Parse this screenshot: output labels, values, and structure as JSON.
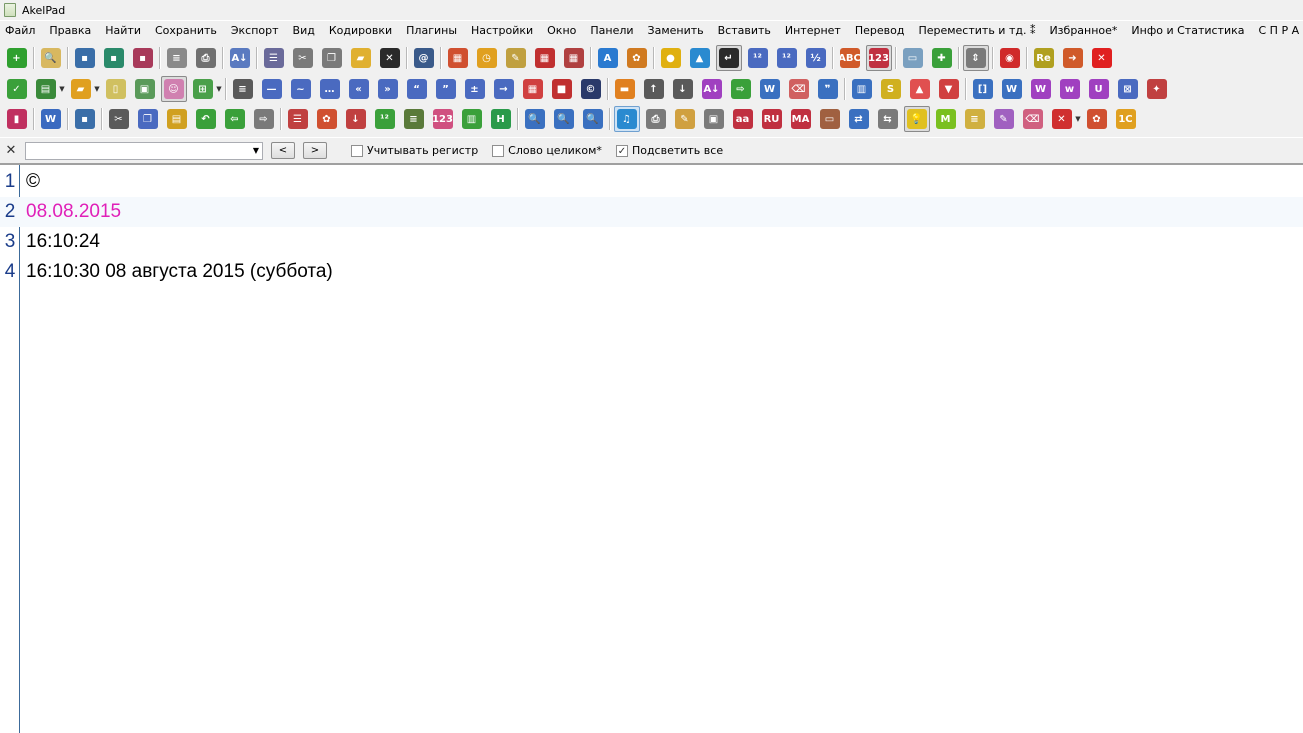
{
  "window": {
    "title": "AkelPad"
  },
  "menu": [
    "Файл",
    "Правка",
    "Найти",
    "Сохранить",
    "Экспорт",
    "Вид",
    "Кодировки",
    "Плагины",
    "Настройки",
    "Окно",
    "Панели",
    "Заменить",
    "Вставить",
    "Интернет",
    "Перевод",
    "Переместить и тд. ⁑",
    "Избранное*",
    "Инфо и Статистика",
    "С П Р А В К А"
  ],
  "toolbar": {
    "row1": [
      {
        "icon": "new-tab-icon",
        "color": "#2fa02f",
        "glyph": "+"
      },
      "sep",
      {
        "icon": "preview-icon",
        "color": "#d8b860",
        "glyph": "🔍"
      },
      "sep",
      {
        "icon": "save-icon",
        "color": "#3a6ea8",
        "glyph": "▪"
      },
      {
        "icon": "save-as-icon",
        "color": "#2a8a6a",
        "glyph": "▪"
      },
      {
        "icon": "save-all-icon",
        "color": "#a83a5a",
        "glyph": "▪"
      },
      "sep",
      {
        "icon": "document-icon",
        "color": "#8a8a8a",
        "glyph": "≡"
      },
      {
        "icon": "print-icon",
        "color": "#707070",
        "glyph": "⎙"
      },
      "sep",
      {
        "icon": "sort-icon",
        "color": "#5a7ac0",
        "glyph": "A↓"
      },
      "sep",
      {
        "icon": "list-icon",
        "color": "#6a6a9a",
        "glyph": "☰"
      },
      {
        "icon": "cut-icon",
        "color": "#7a7a7a",
        "glyph": "✂"
      },
      {
        "icon": "copy-icon",
        "color": "#7a7a7a",
        "glyph": "❐"
      },
      {
        "icon": "open-folder-icon",
        "color": "#e0b030",
        "glyph": "▰"
      },
      {
        "icon": "close-doc-icon",
        "color": "#2a2a2a",
        "glyph": "✕"
      },
      "sep",
      {
        "icon": "at-icon",
        "color": "#3a5a8a",
        "glyph": "@"
      },
      "sep",
      {
        "icon": "calendar-icon",
        "color": "#d05030",
        "glyph": "▦"
      },
      {
        "icon": "clock-icon",
        "color": "#e0a020",
        "glyph": "◷"
      },
      {
        "icon": "notes-icon",
        "color": "#c0a040",
        "glyph": "✎"
      },
      {
        "icon": "calendar-date-icon",
        "color": "#c03030",
        "glyph": "▦"
      },
      {
        "icon": "calendar-week-icon",
        "color": "#b04040",
        "glyph": "▦"
      },
      "sep",
      {
        "icon": "font-icon",
        "color": "#2a7ad0",
        "glyph": "A"
      },
      {
        "icon": "palette-icon",
        "color": "#d07a20",
        "glyph": "✿"
      },
      "sep",
      {
        "icon": "keyhole-icon",
        "color": "#e0b010",
        "glyph": "●"
      },
      {
        "icon": "triangle-up-icon",
        "color": "#2a8ad0",
        "glyph": "▲"
      },
      {
        "icon": "word-wrap-icon",
        "color": "#2a2a2a",
        "glyph": "↵",
        "state": "pressed"
      },
      {
        "icon": "numbering-icon",
        "color": "#4a6ac0",
        "glyph": "¹²"
      },
      {
        "icon": "numbering-inline-icon",
        "color": "#4a6ac0",
        "glyph": "¹²"
      },
      {
        "icon": "fraction-icon",
        "color": "#4a6ac0",
        "glyph": "½"
      },
      "sep",
      {
        "icon": "spellcheck-icon",
        "color": "#d05a2a",
        "glyph": "ABC"
      },
      {
        "icon": "numbers-123-icon",
        "color": "#c03040",
        "glyph": "123",
        "state": "pressed"
      },
      "sep",
      {
        "icon": "window-icon",
        "color": "#7aa0c0",
        "glyph": "▭"
      },
      {
        "icon": "plugin-icon",
        "color": "#3aa03a",
        "glyph": "✚"
      },
      "sep",
      {
        "icon": "scroll-icon",
        "color": "#7a7a7a",
        "glyph": "⇕",
        "state": "pressed"
      },
      "sep",
      {
        "icon": "stop-icon",
        "color": "#d02a2a",
        "glyph": "◉"
      },
      "sep",
      {
        "icon": "regex-icon",
        "color": "#b0a020",
        "glyph": "Re"
      },
      {
        "icon": "exit-icon",
        "color": "#d05a2a",
        "glyph": "➜"
      },
      {
        "icon": "close-red-icon",
        "color": "#e02020",
        "glyph": "✕"
      }
    ],
    "row2": [
      {
        "icon": "check-green-icon",
        "color": "#3aa03a",
        "glyph": "✓"
      },
      {
        "icon": "recent-files-icon",
        "color": "#3a8a3a",
        "glyph": "▤",
        "dropdown": true
      },
      {
        "icon": "open-icon",
        "color": "#e0a020",
        "glyph": "▰",
        "dropdown": true
      },
      {
        "icon": "new-file-icon",
        "color": "#d0c060",
        "glyph": "▯"
      },
      {
        "icon": "insert-file-icon",
        "color": "#5a9a5a",
        "glyph": "▣"
      },
      {
        "icon": "avatar-icon",
        "color": "#d080b0",
        "glyph": "☺",
        "state": "pressed"
      },
      {
        "icon": "grid-check-icon",
        "color": "#4aa04a",
        "glyph": "⊞",
        "dropdown": true
      },
      "sep",
      {
        "icon": "align-left-icon",
        "color": "#5a5a5a",
        "glyph": "≡"
      },
      {
        "icon": "minus-icon",
        "color": "#4a6ac0",
        "glyph": "—"
      },
      {
        "icon": "tilde-icon",
        "color": "#4a6ac0",
        "glyph": "~"
      },
      {
        "icon": "ellipsis-icon",
        "color": "#4a6ac0",
        "glyph": "…"
      },
      {
        "icon": "quote-left-icon",
        "color": "#4a6ac0",
        "glyph": "«"
      },
      {
        "icon": "quote-right-icon",
        "color": "#4a6ac0",
        "glyph": "»"
      },
      {
        "icon": "quote-open-icon",
        "color": "#4a6ac0",
        "glyph": "“"
      },
      {
        "icon": "quote-close-icon",
        "color": "#4a6ac0",
        "glyph": "”"
      },
      {
        "icon": "plus-minus-icon",
        "color": "#4a6ac0",
        "glyph": "±"
      },
      {
        "icon": "arrow-right-icon",
        "color": "#4a6ac0",
        "glyph": "→"
      },
      {
        "icon": "calculator-icon",
        "color": "#d04040",
        "glyph": "▦"
      },
      {
        "icon": "stop-red-icon",
        "color": "#c03030",
        "glyph": "■"
      },
      {
        "icon": "copyright-icon",
        "color": "#2a3a6a",
        "glyph": "©"
      },
      "sep",
      {
        "icon": "insert-line-icon",
        "color": "#e08020",
        "glyph": "▬"
      },
      {
        "icon": "move-up-icon",
        "color": "#5a5a5a",
        "glyph": "↑"
      },
      {
        "icon": "move-down-icon",
        "color": "#5a5a5a",
        "glyph": "↓"
      },
      {
        "icon": "sort-az-icon",
        "color": "#a040c0",
        "glyph": "A↓"
      },
      {
        "icon": "export-icon",
        "color": "#3aa03a",
        "glyph": "⇨"
      },
      {
        "icon": "word-check-icon",
        "color": "#3a70c0",
        "glyph": "W"
      },
      {
        "icon": "eraser-icon",
        "color": "#d06060",
        "glyph": "⌫"
      },
      {
        "icon": "quotes-icon",
        "color": "#3a70c0",
        "glyph": "❞"
      },
      "sep",
      {
        "icon": "book-icon",
        "color": "#3a70c0",
        "glyph": "▥"
      },
      {
        "icon": "s-box-icon",
        "color": "#d0b020",
        "glyph": "S"
      },
      {
        "icon": "up-red-icon",
        "color": "#e05050",
        "glyph": "▲"
      },
      {
        "icon": "down-red-icon",
        "color": "#d04040",
        "glyph": "▼"
      },
      "sep",
      {
        "icon": "bracket-icon",
        "color": "#3a70c0",
        "glyph": "[]"
      },
      {
        "icon": "word-replace-icon",
        "color": "#3a70c0",
        "glyph": "W"
      },
      {
        "icon": "word-upper-icon",
        "color": "#a040c0",
        "glyph": "W"
      },
      {
        "icon": "word-lower-icon",
        "color": "#a040c0",
        "glyph": "w"
      },
      {
        "icon": "u-case-icon",
        "color": "#a040c0",
        "glyph": "U"
      },
      {
        "icon": "close-box-icon",
        "color": "#4a6ac0",
        "glyph": "⊠"
      },
      {
        "icon": "pin-icon",
        "color": "#c04040",
        "glyph": "✦"
      }
    ],
    "row3": [
      {
        "icon": "bookmarks-icon",
        "color": "#c03060",
        "glyph": "▮"
      },
      "sep",
      {
        "icon": "word-doc-icon",
        "color": "#3a6ac0",
        "glyph": "W"
      },
      "sep",
      {
        "icon": "save-small-icon",
        "color": "#3a6ea8",
        "glyph": "▪"
      },
      "sep",
      {
        "icon": "scissors-icon",
        "color": "#5a5a5a",
        "glyph": "✂"
      },
      {
        "icon": "copy-doc-icon",
        "color": "#4a6ac0",
        "glyph": "❐"
      },
      {
        "icon": "paste-icon",
        "color": "#d0a020",
        "glyph": "▤"
      },
      {
        "icon": "undo-icon",
        "color": "#3aa03a",
        "glyph": "↶"
      },
      {
        "icon": "back-arrow-icon",
        "color": "#3aa03a",
        "glyph": "⇦"
      },
      {
        "icon": "forward-arrow-icon",
        "color": "#7a7a7a",
        "glyph": "⇨"
      },
      "sep",
      {
        "icon": "list-lines-icon",
        "color": "#c04040",
        "glyph": "☰"
      },
      {
        "icon": "flowers-icon",
        "color": "#d05030",
        "glyph": "✿"
      },
      {
        "icon": "sort-19-icon",
        "color": "#c04040",
        "glyph": "↓"
      },
      {
        "icon": "sort-123-icon",
        "color": "#3aa03a",
        "glyph": "¹²"
      },
      {
        "icon": "numbered-list-icon",
        "color": "#5a7a3a",
        "glyph": "≡"
      },
      {
        "icon": "numbers-color-icon",
        "color": "#d05080",
        "glyph": "123"
      },
      {
        "icon": "color-chart-icon",
        "color": "#3aa03a",
        "glyph": "▥"
      },
      {
        "icon": "heading-icon",
        "color": "#2a9a4a",
        "glyph": "H"
      },
      "sep",
      {
        "icon": "find-icon",
        "color": "#3a70c0",
        "glyph": "🔍"
      },
      {
        "icon": "find-replace-icon",
        "color": "#3a70c0",
        "glyph": "🔍"
      },
      {
        "icon": "find-regex-icon",
        "color": "#3a70c0",
        "glyph": "🔍"
      },
      "sep",
      {
        "icon": "music-icon",
        "color": "#2a8ad0",
        "glyph": "♫",
        "state": "blue-pressed"
      },
      {
        "icon": "printer-icon",
        "color": "#7a7a7a",
        "glyph": "⎙"
      },
      {
        "icon": "pen-icon",
        "color": "#d0a040",
        "glyph": "✎"
      },
      {
        "icon": "image-icon",
        "color": "#7a7a7a",
        "glyph": "▣"
      },
      {
        "icon": "lower-case-icon",
        "color": "#c03040",
        "glyph": "aa"
      },
      {
        "icon": "ru-en-icon",
        "color": "#c03040",
        "glyph": "RU"
      },
      {
        "icon": "case-toggle-icon",
        "color": "#c03040",
        "glyph": "MA"
      },
      {
        "icon": "briefcase-icon",
        "color": "#a06040",
        "glyph": "▭"
      },
      {
        "icon": "swap-icon",
        "color": "#3a70c0",
        "glyph": "⇄"
      },
      {
        "icon": "window-swap-icon",
        "color": "#7a7a7a",
        "glyph": "⇆"
      },
      {
        "icon": "lightbulb-icon",
        "color": "#e0c020",
        "glyph": "💡",
        "state": "pressed"
      },
      {
        "icon": "m-green-icon",
        "color": "#7ac020",
        "glyph": "M"
      },
      {
        "icon": "notepad-icon",
        "color": "#d0b040",
        "glyph": "≡"
      },
      {
        "icon": "marker-icon",
        "color": "#a060c0",
        "glyph": "✎"
      },
      {
        "icon": "eraser-pink-icon",
        "color": "#d06080",
        "glyph": "⌫"
      },
      {
        "icon": "delete-doc-icon",
        "color": "#d03030",
        "glyph": "✕",
        "dropdown": true
      },
      {
        "icon": "flowers-color-icon",
        "color": "#d05030",
        "glyph": "✿"
      },
      {
        "icon": "one-c-icon",
        "color": "#e0a020",
        "glyph": "1C"
      }
    ]
  },
  "findbar": {
    "close_glyph": "✕",
    "query": "",
    "prev_label": "<",
    "next_label": ">",
    "options": [
      {
        "label": "Учитывать регистр",
        "checked": false
      },
      {
        "label": "Слово целиком*",
        "checked": false
      },
      {
        "label": "Подсветить все",
        "checked": true
      }
    ]
  },
  "editor": {
    "current_line": 2,
    "lines": [
      {
        "num": "1",
        "text": "©"
      },
      {
        "num": "2",
        "text": "08.08.2015"
      },
      {
        "num": "3",
        "text": "16:10:24"
      },
      {
        "num": "4",
        "text": "16:10:30 08 августа 2015 (суббота)"
      }
    ]
  }
}
